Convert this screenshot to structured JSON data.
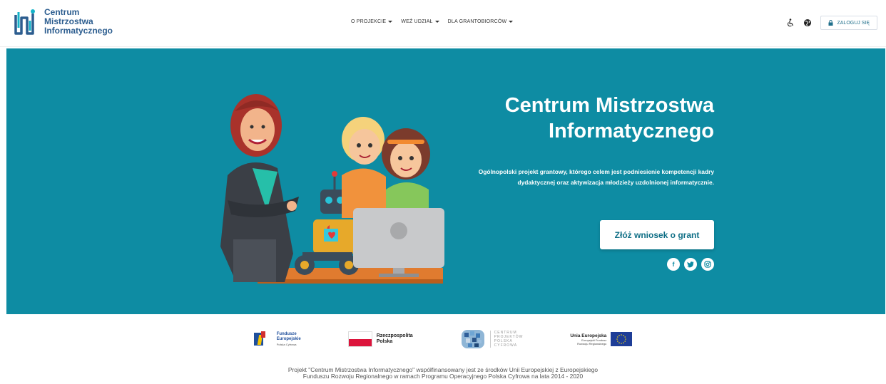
{
  "header": {
    "logo": {
      "line1": "Centrum",
      "line2": "Mistrzostwa",
      "line3": "Informatycznego"
    },
    "nav": [
      {
        "label": "O PROJEKCIE"
      },
      {
        "label": "WEŹ UDZIAŁ"
      },
      {
        "label": "DLA GRANTOBIORCÓW"
      }
    ],
    "accessibility_icon": "wheelchair-icon",
    "language_icon": "globe-icon",
    "login_label": "ZALOGUJ SIĘ",
    "login_icon": "lock-icon"
  },
  "hero": {
    "title": "Centrum Mistrzostwa Informatycznego",
    "description": "Ogólnopolski projekt grantowy, którego celem jest podniesienie kompetencji kadry dydaktycznej oraz aktywizacja młodzieży uzdolnionej informatycznie.",
    "cta_label": "Złóż wniosek o grant",
    "socials": [
      {
        "icon": "facebook-icon",
        "glyph": "f"
      },
      {
        "icon": "twitter-icon",
        "glyph": "t"
      },
      {
        "icon": "instagram-icon",
        "glyph": "◎"
      }
    ],
    "colors": {
      "background": "#0e8ca3",
      "cta_text": "#0f6f86"
    }
  },
  "footer_logos": {
    "fe": {
      "name": "Fundusze Europejskie",
      "line1": "Fundusze",
      "line2": "Europejskie",
      "sub": "Polska Cyfrowa"
    },
    "pl": {
      "line1": "Rzeczpospolita",
      "line2": "Polska"
    },
    "cpc": {
      "line1": "CENTRUM",
      "line2": "PROJEKTÓW",
      "line3": "POLSKA",
      "line4": "CYFROWA"
    },
    "ue": {
      "line1": "Unia Europejska",
      "sub1": "Europejski Fundusz",
      "sub2": "Rozwoju Regionalnego"
    }
  },
  "footer_text": {
    "line1": "Projekt \"Centrum Mistrzostwa Informatycznego\" współfinansowany jest ze środków Unii Europejskiej z Europejskiego",
    "line2": "Funduszu Rozwoju Regionalnego w ramach Programu Operacyjnego Polska Cyfrowa na lata 2014 - 2020"
  }
}
